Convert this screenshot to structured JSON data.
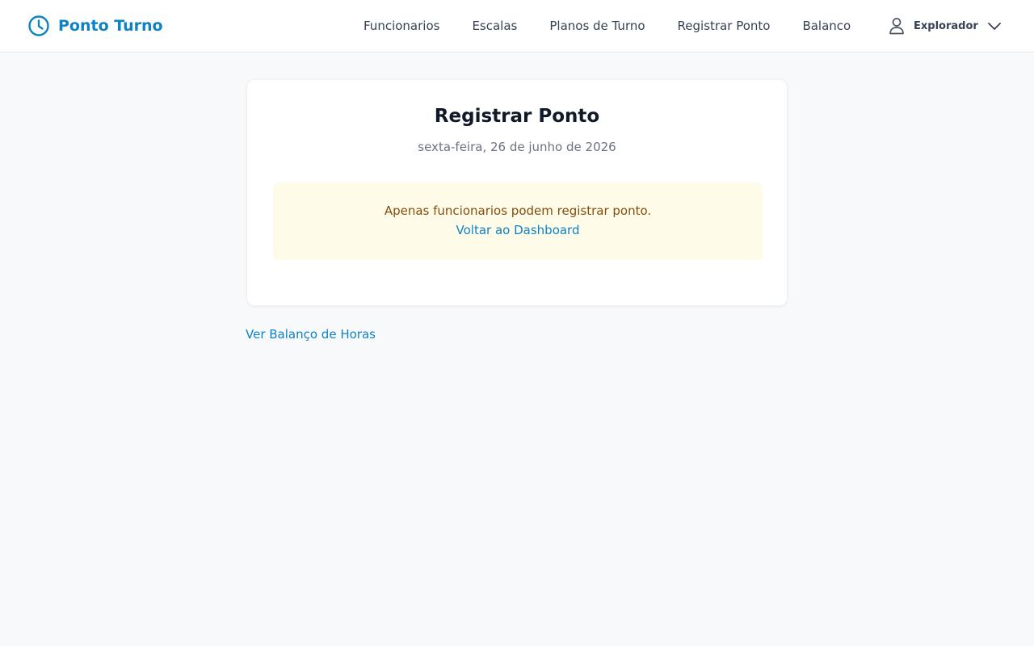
{
  "header": {
    "brand": {
      "name": "Ponto Turno",
      "icon": "clock-icon"
    },
    "nav": [
      {
        "label": "Funcionarios"
      },
      {
        "label": "Escalas"
      },
      {
        "label": "Planos de Turno"
      },
      {
        "label": "Registrar Ponto"
      },
      {
        "label": "Balanco"
      }
    ],
    "user": {
      "name": "Explorador",
      "icon": "user-icon",
      "menu_icon": "chevron-down-icon"
    }
  },
  "card": {
    "title": "Registrar Ponto",
    "date": "sexta-feira, 26 de junho de 2026",
    "notice": {
      "message": "Apenas funcionarios podem registrar ponto.",
      "link": "Voltar ao Dashboard"
    }
  },
  "footer_link": "Ver Balanço de Horas",
  "colors": {
    "accent": "#0e82c5",
    "notice_background": "#fefbe8",
    "notice_text": "#854d0e",
    "page_background": "#f8f9fb"
  }
}
